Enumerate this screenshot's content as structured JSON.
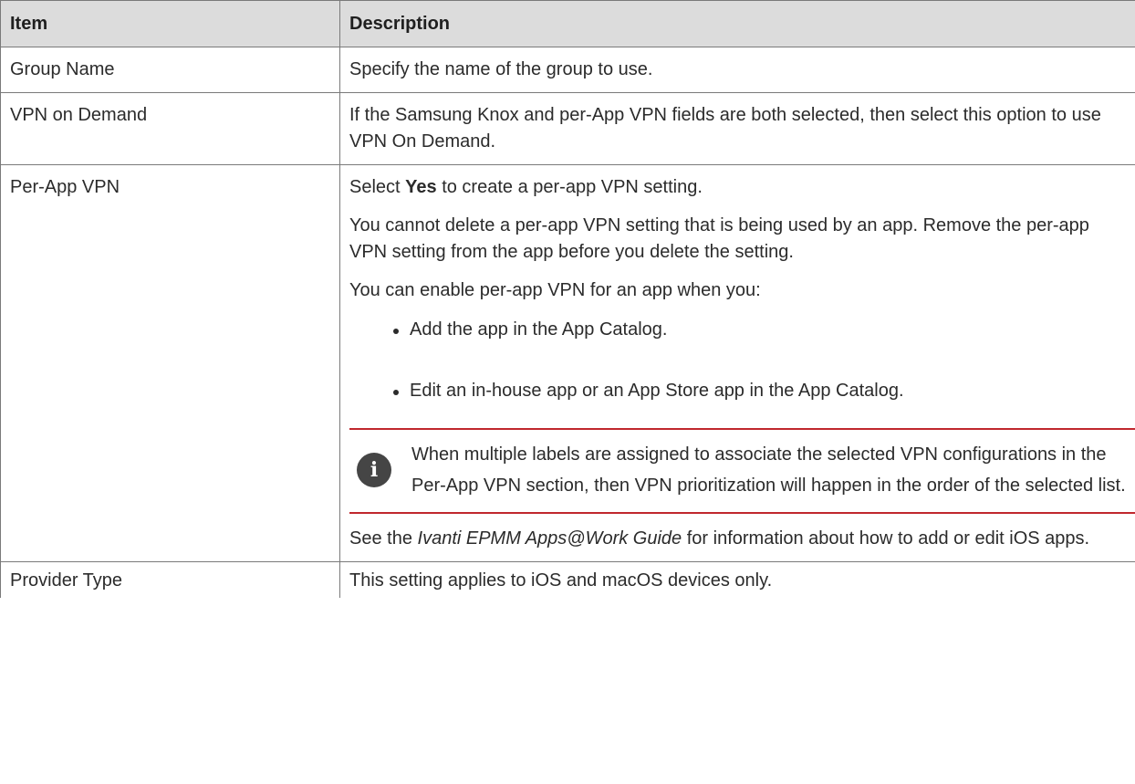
{
  "table": {
    "headers": {
      "item": "Item",
      "description": "Description"
    },
    "rows": {
      "group_name": {
        "item": "Group Name",
        "description": "Specify the name of the group to use."
      },
      "vpn_on_demand": {
        "item": "VPN on Demand",
        "description": "If the Samsung Knox and per-App VPN fields are both selected, then select this option to use VPN On Demand."
      },
      "per_app_vpn": {
        "item": "Per-App VPN",
        "select_prefix": "Select ",
        "select_bold": "Yes",
        "select_suffix": " to create a per-app VPN setting.",
        "cannot_delete": "You cannot delete a per-app VPN setting that is being used by an app. Remove the per-app VPN setting from the app before you delete the setting.",
        "enable_intro": "You can enable per-app VPN for an app when you:",
        "bullets": [
          "Add the app in the App Catalog.",
          "Edit an in-house app or an App Store app in the App Catalog."
        ],
        "note": "When multiple labels are assigned to associate the selected VPN configurations in the Per-App VPN section, then VPN prioritization will happen in the order of the selected list.",
        "note_icon": "info-icon",
        "see_prefix": "See the ",
        "see_guide": "Ivanti EPMM Apps@Work Guide",
        "see_suffix": " for information about how to add or edit iOS apps."
      },
      "provider_type": {
        "item": "Provider Type",
        "description": "This setting applies to iOS and macOS devices only."
      }
    }
  },
  "colors": {
    "header_bg": "#dcdcdc",
    "note_rule": "#c0272d",
    "icon_bg": "#454545"
  }
}
